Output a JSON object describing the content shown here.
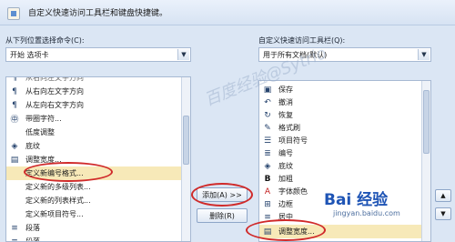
{
  "header": {
    "title": "自定义快速访问工具栏和键盘快捷键。"
  },
  "left": {
    "choose_label": "从下列位置选择命令(C):",
    "choose_value": "开始 选项卡",
    "items": [
      {
        "label": "从右向左文字方向",
        "icon": "rtl-icon"
      },
      {
        "label": "从左向右文字方向",
        "icon": "ltr-icon"
      },
      {
        "label": "带圈字符...",
        "icon": "enclosed-char-icon"
      },
      {
        "label": "低度调整",
        "icon": "adjust-icon"
      },
      {
        "label": "底纹",
        "icon": "shading-icon"
      },
      {
        "label": "调整宽度...",
        "icon": "width-icon"
      },
      {
        "label": "定义新编号格式...",
        "icon": ""
      },
      {
        "label": "定义新的多级列表...",
        "icon": ""
      },
      {
        "label": "定义新的列表样式...",
        "icon": ""
      },
      {
        "label": "定义新项目符号...",
        "icon": ""
      },
      {
        "label": "段落",
        "icon": "paragraph-icon"
      },
      {
        "label": "段落",
        "icon": "paragraph-icon"
      }
    ]
  },
  "buttons": {
    "add": "添加(A) >>",
    "remove": "删除(R)"
  },
  "right": {
    "customize_label": "自定义快速访问工具栏(Q):",
    "customize_value": "用于所有文档(默认)",
    "items": [
      {
        "label": "保存",
        "icon": "save-icon"
      },
      {
        "label": "撤消",
        "icon": "undo-icon"
      },
      {
        "label": "恢复",
        "icon": "redo-icon"
      },
      {
        "label": "格式刷",
        "icon": "format-painter-icon"
      },
      {
        "label": "项目符号",
        "icon": "bullets-icon"
      },
      {
        "label": "编号",
        "icon": "numbering-icon"
      },
      {
        "label": "底纹",
        "icon": "shading-icon"
      },
      {
        "label": "加粗",
        "icon": "bold-icon"
      },
      {
        "label": "字体颜色",
        "icon": "font-color-icon"
      },
      {
        "label": "边框",
        "icon": "border-icon"
      },
      {
        "label": "居中",
        "icon": "center-icon"
      },
      {
        "label": "调整宽度...",
        "icon": "width-icon"
      }
    ]
  },
  "watermarks": {
    "main": "百度经验@Sytrio",
    "logo": "Bai 经验",
    "url": "jingyan.baidu.com"
  }
}
